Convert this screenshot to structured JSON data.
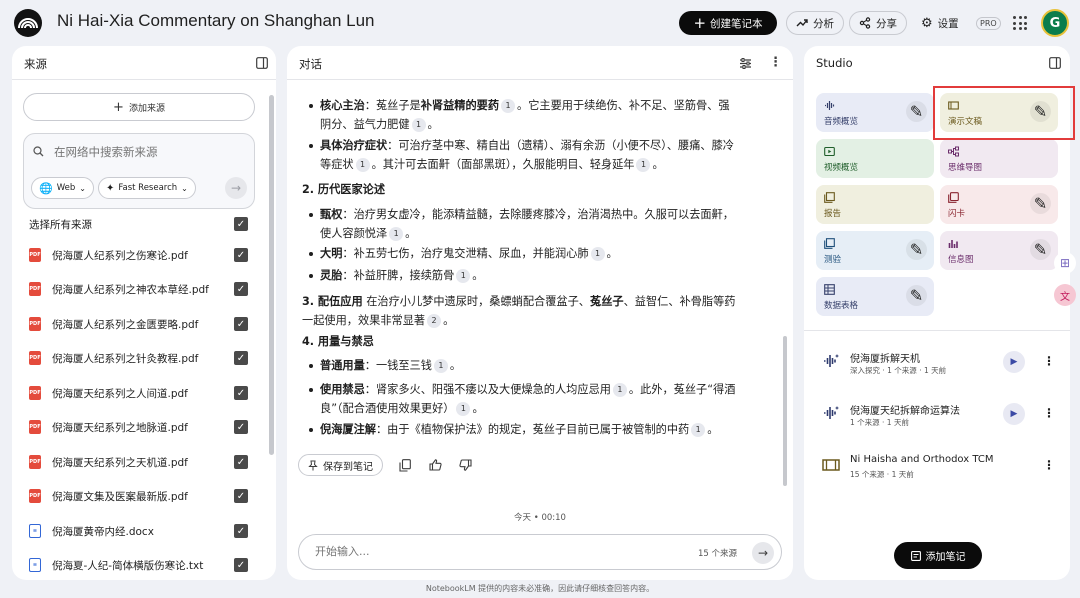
{
  "app": {
    "title": "Ni Hai-Xia Commentary on Shanghan Lun",
    "create_notebook": "创建笔记本",
    "analytics": "分析",
    "share": "分享",
    "settings": "设置",
    "pro_badge": "PRO",
    "avatar_letter": "G"
  },
  "sources": {
    "title": "来源",
    "add_button": "添加来源",
    "search_placeholder": "在网络中搜索新来源",
    "chip_web": "Web",
    "chip_research": "Fast Research",
    "select_all": "选择所有来源",
    "items": [
      {
        "name": "倪海厦人纪系列之伤寒论.pdf",
        "type": "PDF"
      },
      {
        "name": "倪海厦人纪系列之神农本草经.pdf",
        "type": "PDF"
      },
      {
        "name": "倪海厦人纪系列之金匮要略.pdf",
        "type": "PDF"
      },
      {
        "name": "倪海厦人纪系列之针灸教程.pdf",
        "type": "PDF"
      },
      {
        "name": "倪海厦天纪系列之人间道.pdf",
        "type": "PDF"
      },
      {
        "name": "倪海厦天纪系列之地脉道.pdf",
        "type": "PDF"
      },
      {
        "name": "倪海厦天纪系列之天机道.pdf",
        "type": "PDF"
      },
      {
        "name": "倪海厦文集及医案最新版.pdf",
        "type": "PDF"
      },
      {
        "name": "倪海厦黄帝内经.docx",
        "type": "DOC"
      },
      {
        "name": "倪海夏-人纪-简体横版伤寒论.txt",
        "type": "TXT"
      }
    ]
  },
  "chat": {
    "title": "对话",
    "b1_label": "核心主治",
    "b1_pre": "：菟丝子是",
    "b1_bold": "补肾益精的要药",
    "b1_cite": "1",
    "b1_post": "。它主要用于续绝伤、补不足、坚筋骨、强",
    "b1_line2": "阴分、益气力肥健",
    "b1_cite2": "1",
    "b2_label": "具体治疗症状",
    "b2_text": "：可治疗茎中寒、精自出（遗精）、溺有余沥（小便不尽）、腰痛、膝冷",
    "b2_line2": "等症状",
    "b2_cite": "1",
    "b2_post": "。其汁可去面鼾（面部黑斑），久服能明目、轻身延年",
    "b2_cite2": "1",
    "s2_title": "2. 历代医家论述",
    "b3_label": "甄权",
    "b3_text": "：治疗男女虚冷，能添精益髓，去除腰疼膝冷，治消渴热中。久服可以去面鼾，",
    "b3_line2": "使人容颜悦泽",
    "b3_cite": "1",
    "b4_label": "大明",
    "b4_text": "：补五劳七伤，治疗鬼交泄精、尿血，并能润心肺",
    "b4_cite": "1",
    "b5_label": "灵胎",
    "b5_text": "：补益肝脾，接续筋骨",
    "b5_cite": "1",
    "s3_title": "3. 配伍应用",
    "s3_text": " 在治疗小儿梦中遗尿时，桑螵蛸配合覆盆子、",
    "s3_bold": "菟丝子",
    "s3_text2": "、益智仁、补骨脂等药",
    "s3_line2": "一起使用，效果非常显著",
    "s3_cite": "2",
    "s4_title": "4. 用量与禁忌",
    "b6_label": "普通用量",
    "b6_text": "：一钱至三钱",
    "b6_cite": "1",
    "b7_label": "使用禁忌",
    "b7_text": "：肾家多火、阳强不痿以及大便燥急的人均应忌用",
    "b7_cite": "1",
    "b7_post": "。此外，菟丝子“得酒",
    "b7_line2": "良”（配合酒使用效果更好）",
    "b7_cite2": "1",
    "b8_label": "倪海厦注解",
    "b8_text": "：由于《植物保护法》的规定，菟丝子目前已属于被管制的中药",
    "b8_cite": "1",
    "save_to_note": "保存到笔记",
    "timestamp": "今天 • 00:10",
    "input_placeholder": "开始输入...",
    "source_count": "15 个来源"
  },
  "studio": {
    "title": "Studio",
    "tiles": [
      {
        "label": "音频概览",
        "bg": "#e8ebf6",
        "fg": "#36406b"
      },
      {
        "label": "演示文稿",
        "bg": "#f0efdf",
        "fg": "#6b5a1e"
      },
      {
        "label": "视频概览",
        "bg": "#e3f0e4",
        "fg": "#1f5e2a"
      },
      {
        "label": "思维导图",
        "bg": "#f1e9f1",
        "fg": "#6b2d6b"
      },
      {
        "label": "报告",
        "bg": "#f0efdf",
        "fg": "#6b5a1e"
      },
      {
        "label": "闪卡",
        "bg": "#f8e9ea",
        "fg": "#8a2530"
      },
      {
        "label": "测验",
        "bg": "#e6eef6",
        "fg": "#1e4f7a"
      },
      {
        "label": "信息图",
        "bg": "#f1e9f1",
        "fg": "#6b2d6b"
      },
      {
        "label": "数据表格",
        "bg": "#e8ebf6",
        "fg": "#36406b"
      }
    ],
    "notes": [
      {
        "title": "倪海厦拆解天机",
        "meta": "深入探究 · 1 个来源 · 1 天前"
      },
      {
        "title": "倪海厦天纪拆解命运算法",
        "meta": "1 个来源 · 1 天前"
      },
      {
        "title": "Ni Haisha and Orthodox TCM",
        "meta": "15 个来源 · 1 天前"
      }
    ],
    "add_note": "添加笔记"
  },
  "footer": "NotebookLM 提供的内容未必准确，因此请仔细核查回答内容。"
}
